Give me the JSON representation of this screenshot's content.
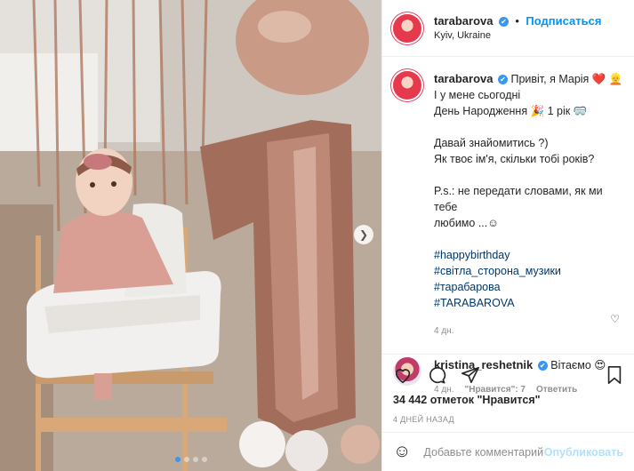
{
  "header": {
    "username": "tarabarova",
    "verified_glyph": "✔",
    "separator": "•",
    "follow_label": "Подписаться",
    "location": "Kyiv, Ukraine"
  },
  "caption": {
    "username": "tarabarova",
    "lines": [
      "Привіт, я Марія ❤️ 👱",
      "І у мене сьогодні",
      "День Народження 🎉 1 рік 🥽",
      "",
      "Давай знайомитись ?)",
      "Як твоє ім'я, скільки тобі років?",
      "",
      "P.s.: не передати словами, як ми тебе",
      "любимо ...☺",
      ""
    ],
    "hashtags": [
      "#happybirthday",
      "#світла_сторона_музики",
      "#тарабарова",
      "#TARABAROVA"
    ],
    "time": "4 дн."
  },
  "comment": {
    "username": "kristina_reshetnik",
    "text": "Вітаємо 😍",
    "time": "4 дн.",
    "likes": "\"Нравится\": 7",
    "reply_label": "Ответить"
  },
  "actions": {
    "likes_count": "34 442 отметок \"Нравится\"",
    "date": "4 ДНЕЙ НАЗАД"
  },
  "composer": {
    "placeholder": "Добавьте комментарий...",
    "publish_label": "Опубликовать"
  },
  "carousel": {
    "total": 4,
    "active_index": 0
  },
  "colors": {
    "accent": "#0095f6",
    "link": "#00376b",
    "muted": "#8e8e8e",
    "verified": "#3897f0"
  }
}
